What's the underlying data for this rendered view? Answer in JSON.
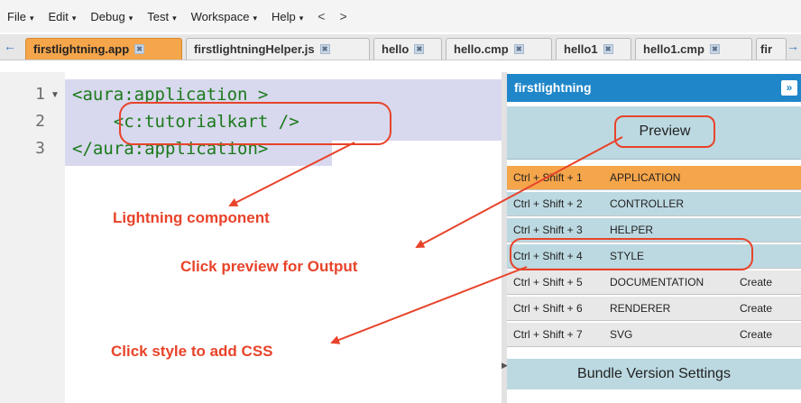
{
  "menu": {
    "items": [
      "File",
      "Edit",
      "Debug",
      "Test",
      "Workspace",
      "Help"
    ],
    "back": "<",
    "forward": ">"
  },
  "tabs": [
    {
      "label": "firstlightning.app",
      "active": true
    },
    {
      "label": "firstlightningHelper.js",
      "active": false
    },
    {
      "label": "hello",
      "active": false
    },
    {
      "label": "hello.cmp",
      "active": false
    },
    {
      "label": "hello1",
      "active": false
    },
    {
      "label": "hello1.cmp",
      "active": false
    },
    {
      "label": "fir",
      "active": false
    }
  ],
  "editor": {
    "line_numbers": [
      "1",
      "2",
      "3"
    ],
    "lines": [
      "<aura:application >",
      "    <c:tutorialkart />",
      "</aura:application>"
    ]
  },
  "annotations": {
    "component": "Lightning component",
    "preview": "Click preview for Output",
    "style": "Click style to add CSS"
  },
  "panel": {
    "title": "firstlightning",
    "preview_label": "Preview",
    "rows": [
      {
        "shortcut": "Ctrl + Shift + 1",
        "name": "APPLICATION",
        "create": "",
        "active": true
      },
      {
        "shortcut": "Ctrl + Shift + 2",
        "name": "CONTROLLER",
        "create": "",
        "active": false
      },
      {
        "shortcut": "Ctrl + Shift + 3",
        "name": "HELPER",
        "create": "",
        "active": false
      },
      {
        "shortcut": "Ctrl + Shift + 4",
        "name": "STYLE",
        "create": "",
        "active": false
      },
      {
        "shortcut": "Ctrl + Shift + 5",
        "name": "DOCUMENTATION",
        "create": "Create",
        "active": false
      },
      {
        "shortcut": "Ctrl + Shift + 6",
        "name": "RENDERER",
        "create": "Create",
        "active": false
      },
      {
        "shortcut": "Ctrl + Shift + 7",
        "name": "SVG",
        "create": "Create",
        "active": false
      }
    ],
    "bundle_settings": "Bundle Version Settings"
  },
  "colors": {
    "active_tab": "#f5a54a",
    "panel_header": "#1f87c9",
    "existing_row": "#bcd9e1",
    "missing_row": "#e8e8e8",
    "annotation": "#e8432a",
    "code": "#1b7a1b"
  }
}
